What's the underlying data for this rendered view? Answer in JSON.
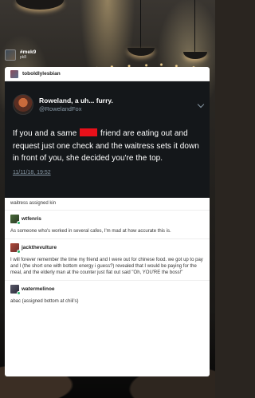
{
  "top_user": {
    "name": "#mek9",
    "sub": "pk8"
  },
  "post": {
    "author": "toboldlylesbian",
    "tweet": {
      "display_name": "Roweland, a uh... furry.",
      "handle": "@RowelandFox",
      "text_before": "If you and a same",
      "text_after": "friend are eating out and request just one check and the waitress sets it down in front of you, she decided you're the top.",
      "timestamp": "11/11/18, 19:52"
    },
    "caption": "waitress assigned kin",
    "reblogs": [
      {
        "user": "wtfenris",
        "text": "As someone who's worked in several cafes, I'm mad at how accurate this is."
      },
      {
        "user": "jackthevulture",
        "text": "I will forever remember the time  my friend and I were out for chinese food. we got up to pay and I (the short one with bottom energy i guess?) revealed that I would be paying for the meal, and the elderly man at the counter just flat out said \"Oh, YOU'RE the boss!\""
      },
      {
        "user": "watermelinoe",
        "text": "abac (assigned bottom at chili's)"
      }
    ]
  },
  "colors": {
    "tweet_bg": "#14171a",
    "redaction": "#e8101a",
    "online_dot": "#2fb46f"
  }
}
